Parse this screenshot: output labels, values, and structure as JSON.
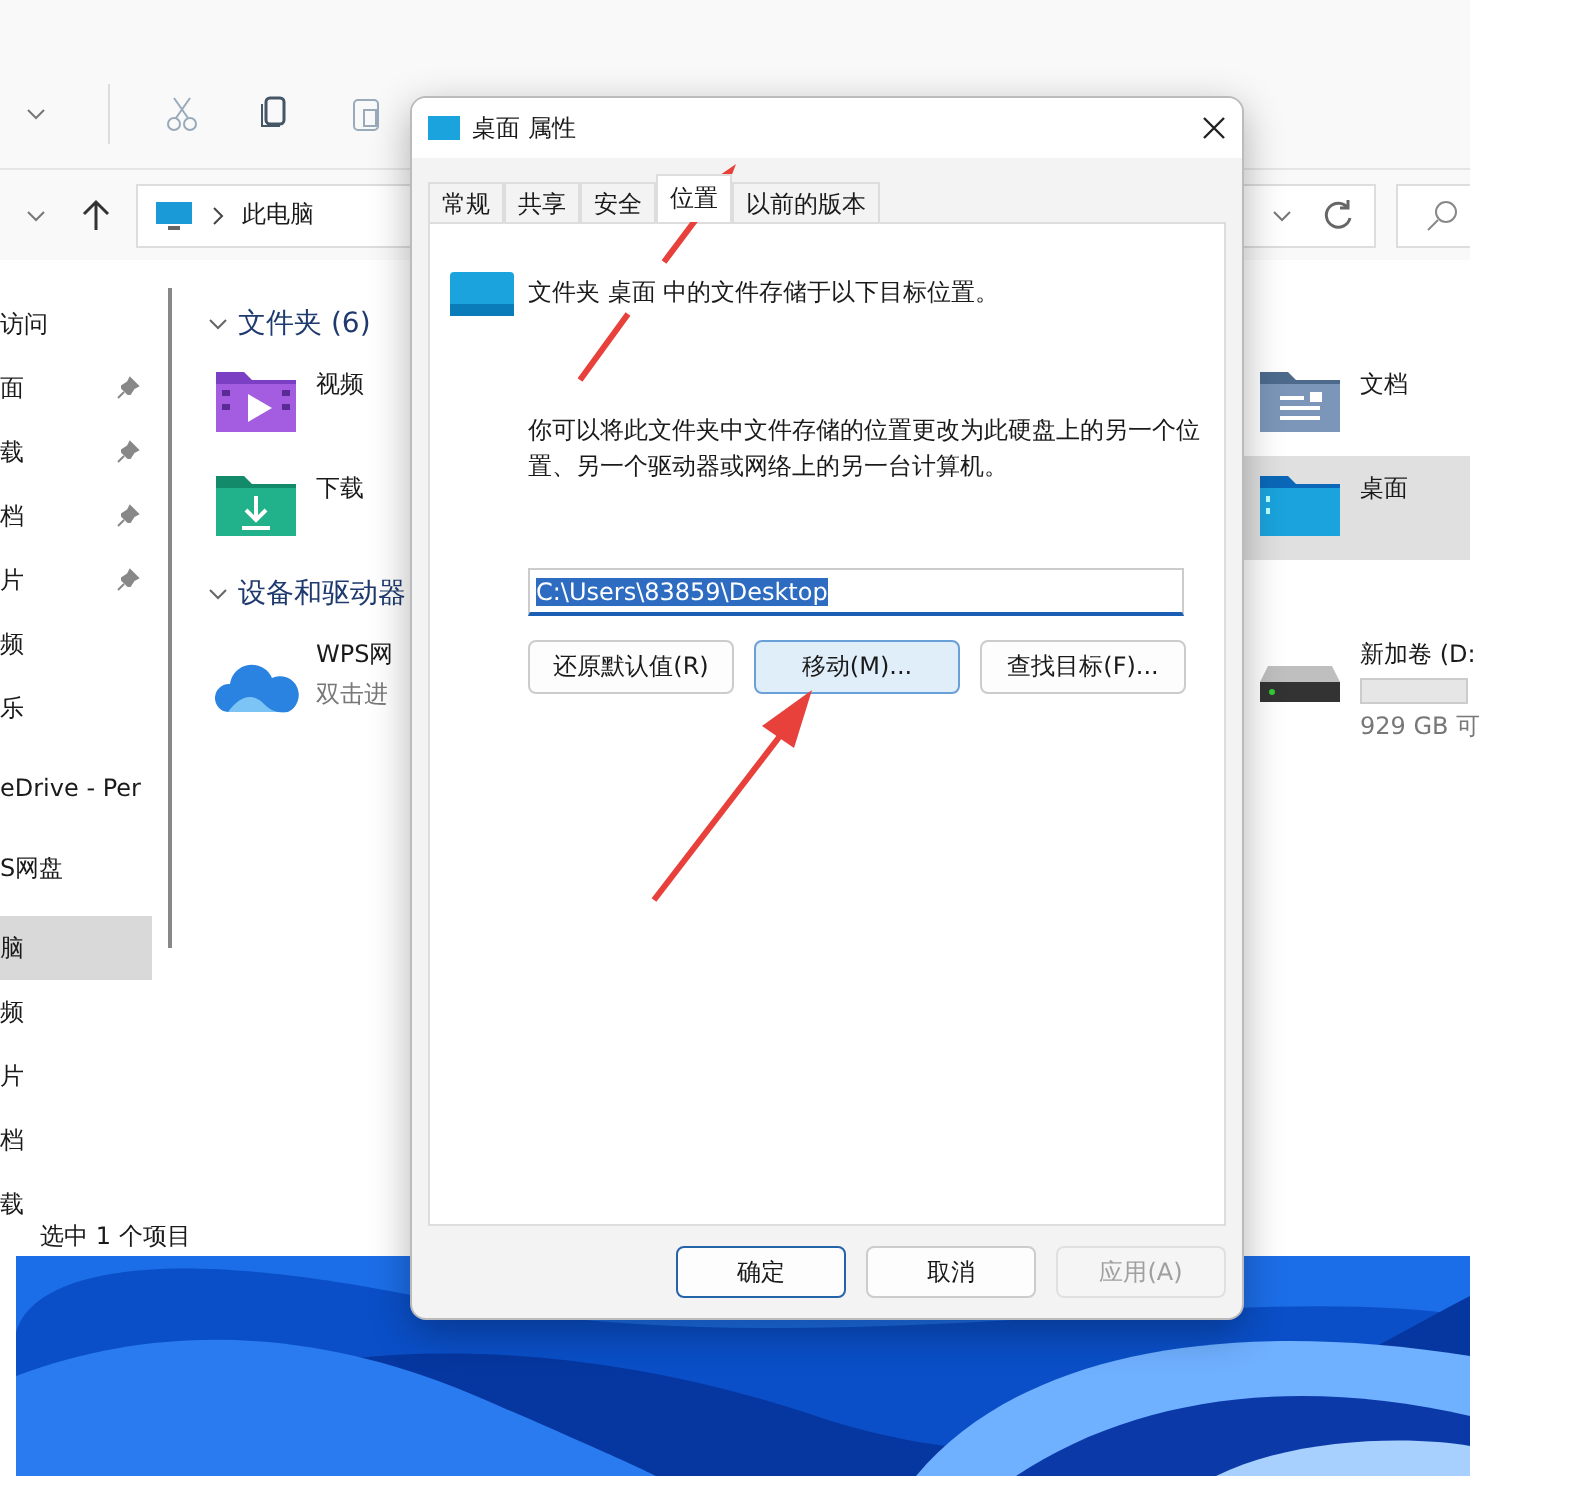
{
  "explorer": {
    "address": {
      "path": "此电脑"
    },
    "sidebar": {
      "sections": [
        {
          "items": [
            {
              "label": "访问",
              "pinned": false,
              "selected": false
            },
            {
              "label": "面",
              "pinned": true,
              "selected": false
            },
            {
              "label": "载",
              "pinned": true,
              "selected": false
            },
            {
              "label": "档",
              "pinned": true,
              "selected": false
            },
            {
              "label": "片",
              "pinned": true,
              "selected": false
            },
            {
              "label": "频",
              "pinned": false,
              "selected": false
            },
            {
              "label": "乐",
              "pinned": false,
              "selected": false
            }
          ]
        },
        {
          "items": [
            {
              "label": "eDrive - Per",
              "pinned": false,
              "selected": false
            }
          ]
        },
        {
          "items": [
            {
              "label": "S网盘",
              "pinned": false,
              "selected": false
            }
          ]
        },
        {
          "items": [
            {
              "label": "脑",
              "pinned": false,
              "selected": true
            },
            {
              "label": "频",
              "pinned": false,
              "selected": false
            },
            {
              "label": "片",
              "pinned": false,
              "selected": false
            },
            {
              "label": "档",
              "pinned": false,
              "selected": false
            },
            {
              "label": "载",
              "pinned": false,
              "selected": false
            }
          ]
        }
      ]
    },
    "content": {
      "sections": [
        {
          "title": "文件夹 (6)",
          "items": [
            {
              "kind": "video-folder",
              "name": "视频",
              "selected": false
            },
            {
              "kind": "documents-folder",
              "name": "文档",
              "selected": false
            },
            {
              "kind": "download-folder",
              "name": "下载",
              "selected": false
            },
            {
              "kind": "desktop-folder",
              "name": "桌面",
              "selected": true
            }
          ]
        },
        {
          "title": "设备和驱动器",
          "items": [
            {
              "kind": "cloud",
              "name": "WPS网",
              "detail": "双击进",
              "selected": false
            },
            {
              "kind": "drive",
              "name": "新加卷 (D:",
              "detail": "929 GB 可",
              "selected": false
            }
          ]
        }
      ]
    },
    "status_bar": "选中 1 个项目"
  },
  "dialog": {
    "title": "桌面 属性",
    "tabs": [
      {
        "label": "常规",
        "selected": false
      },
      {
        "label": "共享",
        "selected": false
      },
      {
        "label": "安全",
        "selected": false
      },
      {
        "label": "位置",
        "selected": true
      },
      {
        "label": "以前的版本",
        "selected": false
      }
    ],
    "location_note": "文件夹 桌面 中的文件存储于以下目标位置。",
    "description": "你可以将此文件夹中文件存储的位置更改为此硬盘上的另一个位置、另一个驱动器或网络上的另一台计算机。",
    "path": {
      "value": "C:\\Users\\83859\\Desktop",
      "highlighted": true
    },
    "actions": [
      {
        "label": "还原默认值(R)",
        "focused": false
      },
      {
        "label": "移动(M)...",
        "focused": true
      },
      {
        "label": "查找目标(F)...",
        "focused": false
      }
    ],
    "buttons": [
      {
        "label": "确定",
        "default": true,
        "disabled": false
      },
      {
        "label": "取消",
        "default": false,
        "disabled": false
      },
      {
        "label": "应用(A)",
        "default": false,
        "disabled": true
      }
    ]
  }
}
